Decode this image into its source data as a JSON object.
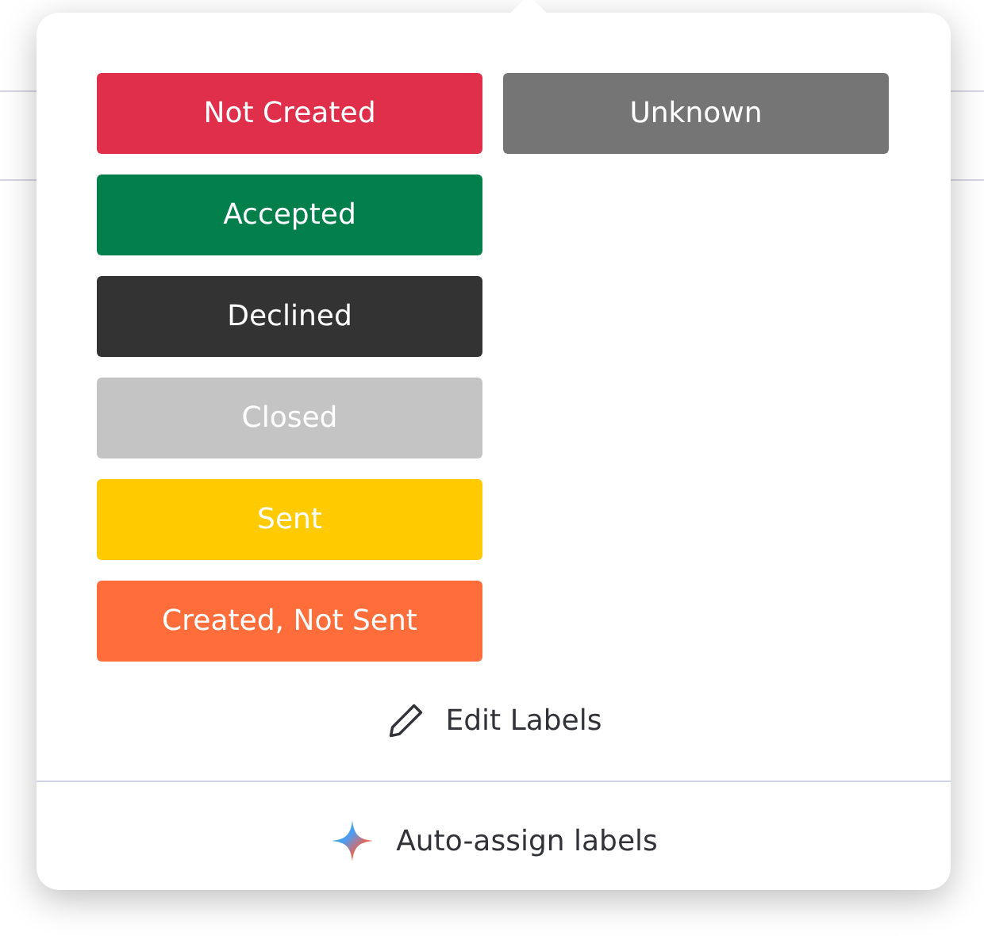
{
  "label_columns": [
    [
      {
        "text": "Not Created",
        "color": "#df2f4a"
      },
      {
        "text": "Accepted",
        "color": "#037f4c"
      },
      {
        "text": "Declined",
        "color": "#333333"
      },
      {
        "text": "Closed",
        "color": "#c4c4c4"
      },
      {
        "text": "Sent",
        "color": "#ffcb00"
      },
      {
        "text": "Created, Not Sent",
        "color": "#ff6d3b"
      }
    ],
    [
      {
        "text": "Unknown",
        "color": "#757575"
      }
    ]
  ],
  "edit_action": {
    "label": "Edit Labels"
  },
  "auto_assign": {
    "label": "Auto-assign labels"
  }
}
